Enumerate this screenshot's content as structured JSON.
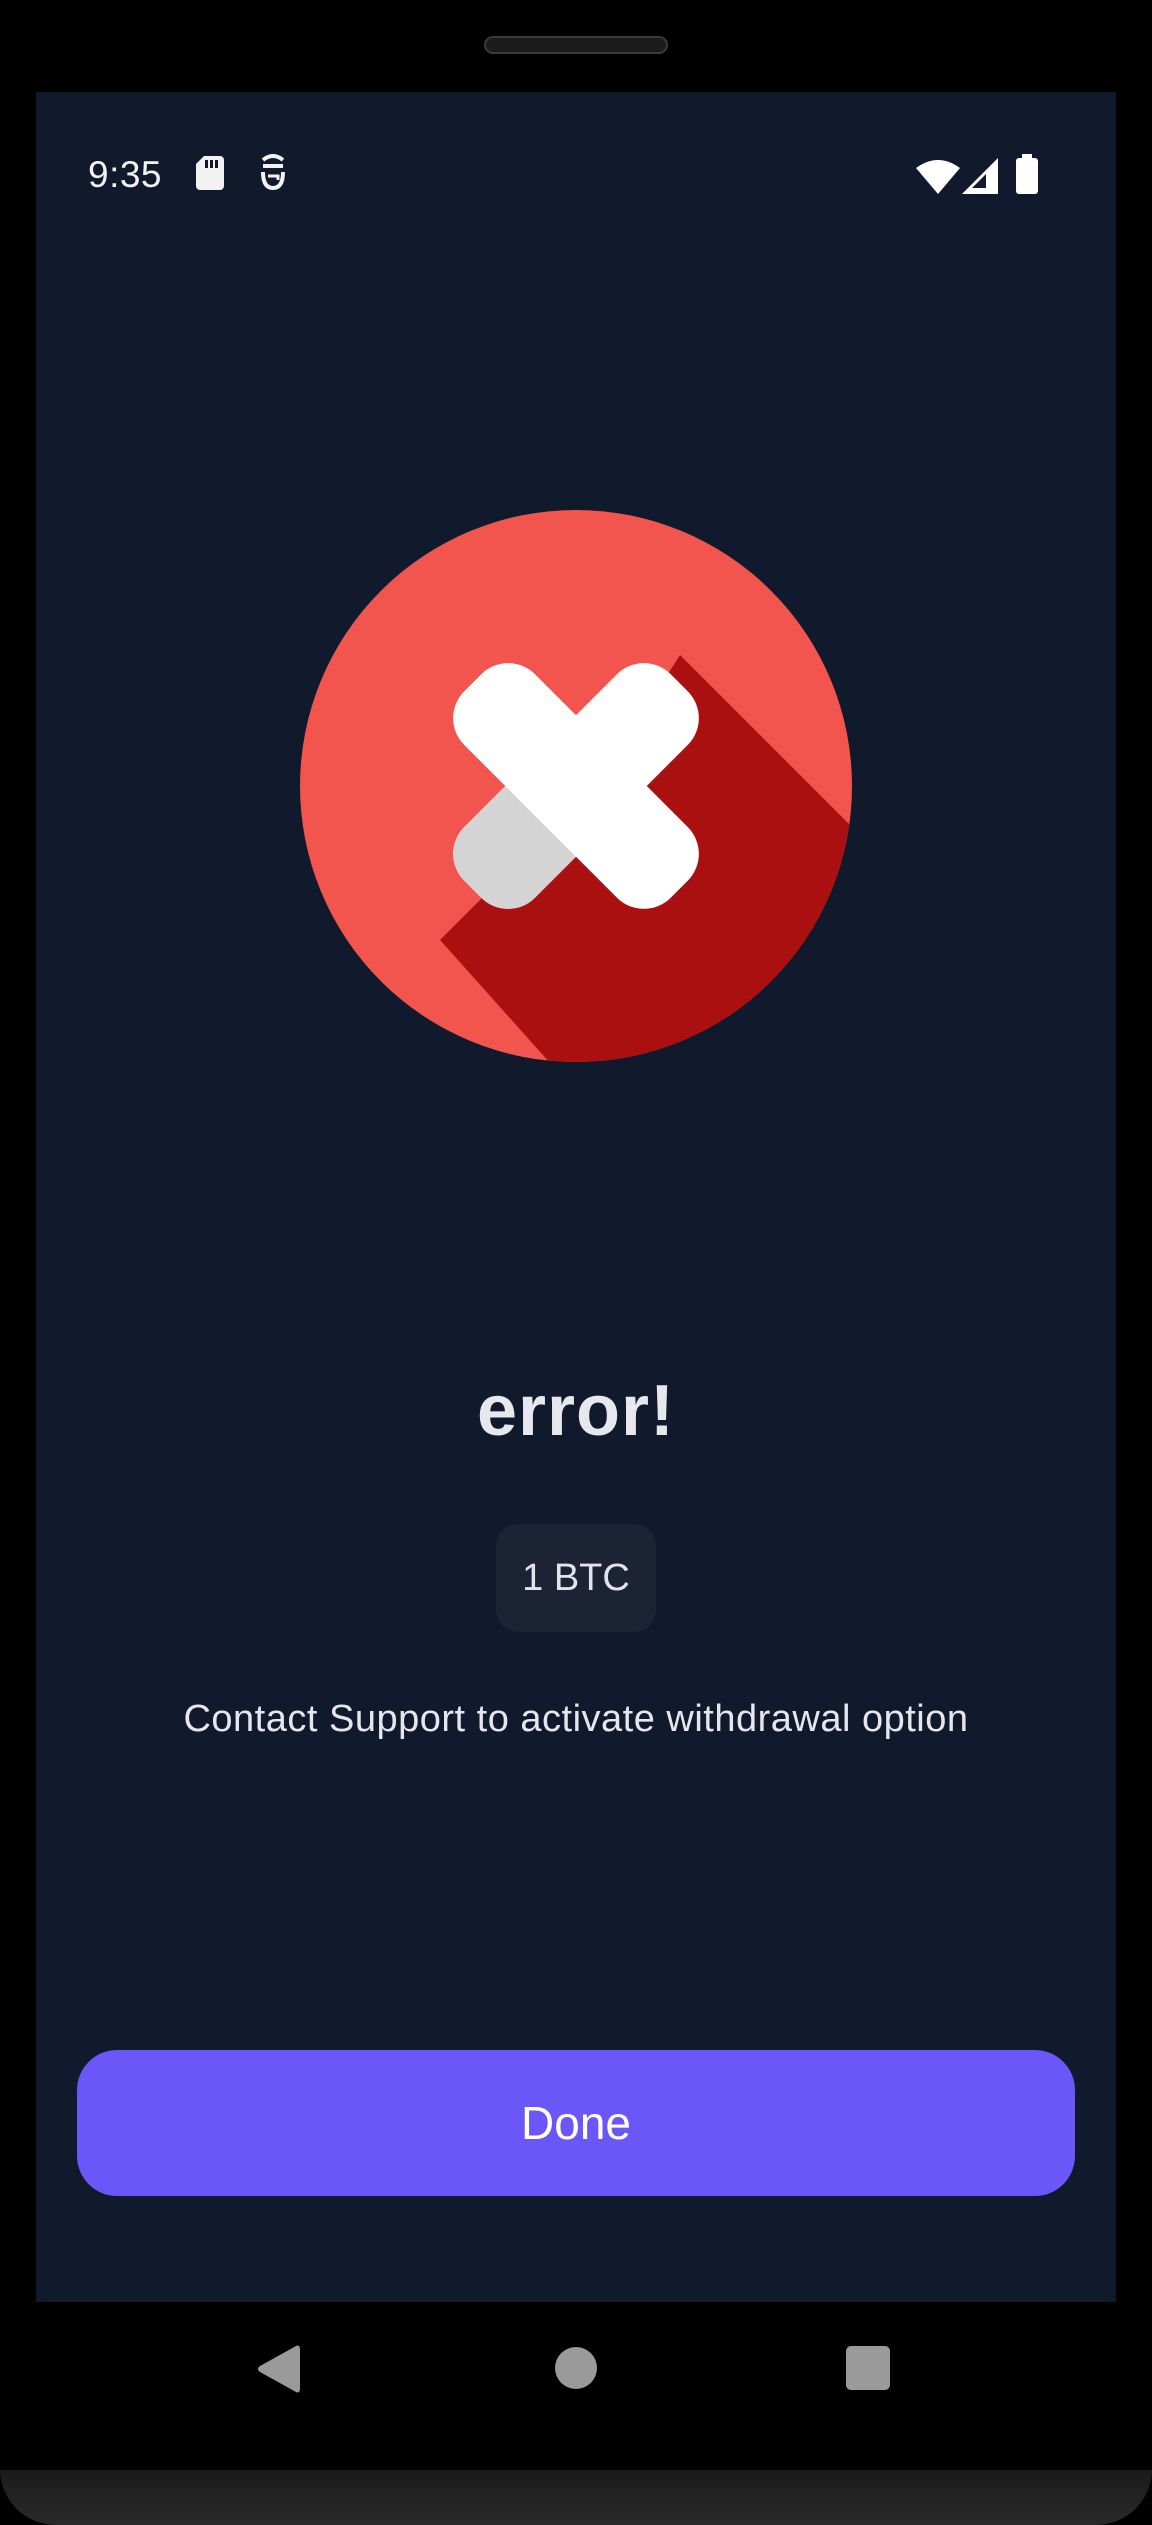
{
  "status_bar": {
    "time": "9:35",
    "icons": [
      "sd-card-icon",
      "face-icon",
      "wifi-icon",
      "signal-icon",
      "battery-icon"
    ]
  },
  "result": {
    "icon": "error-x-icon",
    "title": "error!",
    "amount": "1 BTC",
    "message": "Contact Support to activate withdrawal option"
  },
  "actions": {
    "done_label": "Done"
  },
  "nav": {
    "buttons": [
      "back",
      "home",
      "recents"
    ]
  },
  "colors": {
    "background": "#11192c",
    "error_red": "#f2554d",
    "error_shadow": "#ab1010",
    "button": "#6b56f7"
  }
}
